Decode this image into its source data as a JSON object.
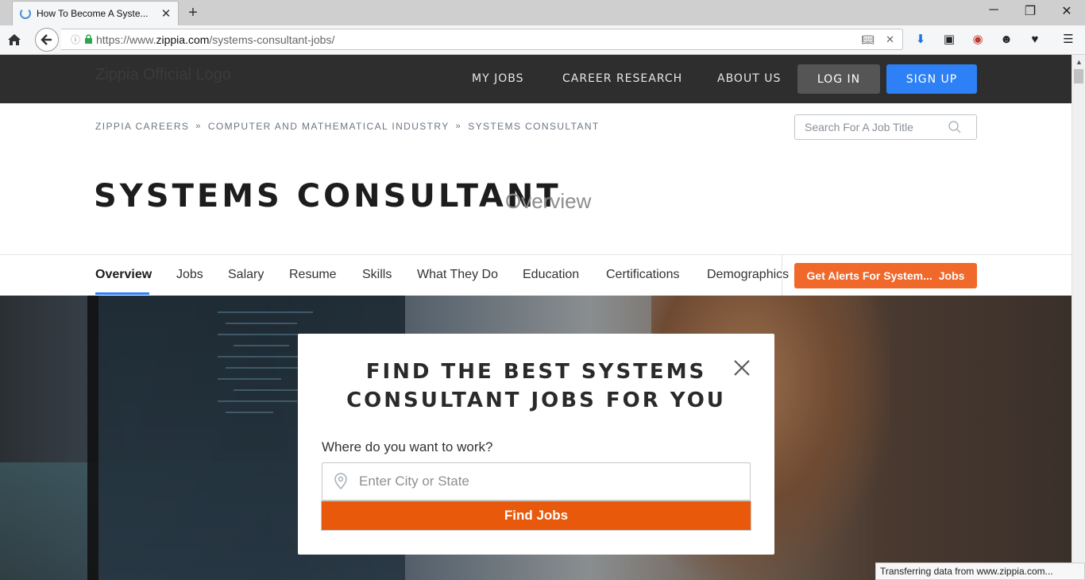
{
  "browser": {
    "tab_title": "How To Become A Syste...",
    "url_prefix": "https://www.",
    "url_domain": "zippia.com",
    "url_path": "/systems-consultant-jobs/",
    "status_text": "Transferring data from www.zippia.com..."
  },
  "header": {
    "logo_alt": "Zippia Official Logo",
    "nav": [
      "MY JOBS",
      "CAREER RESEARCH",
      "ABOUT US"
    ],
    "login_label": "LOG IN",
    "signup_label": "SIGN UP"
  },
  "breadcrumb": [
    "ZIPPIA CAREERS",
    "COMPUTER AND MATHEMATICAL INDUSTRY",
    "SYSTEMS CONSULTANT"
  ],
  "search": {
    "placeholder": "Search For A Job Title"
  },
  "page": {
    "title": "SYSTEMS CONSULTANT",
    "subtitle": "Overview"
  },
  "subnav": {
    "tabs": [
      "Overview",
      "Jobs",
      "Salary",
      "Resume",
      "Skills",
      "What They Do",
      "Education",
      "Certifications",
      "Demographics"
    ],
    "alert_label": "Get Alerts For System...",
    "alert_suffix": "Jobs"
  },
  "modal": {
    "title_line1": "FIND THE BEST SYSTEMS",
    "title_line2": "CONSULTANT JOBS FOR YOU",
    "label": "Where do you want to work?",
    "input_placeholder": "Enter City or State",
    "button_label": "Find Jobs"
  },
  "colors": {
    "header_bg": "#2e2e2e",
    "signup_blue": "#2d80f5",
    "alert_orange": "#f0682a",
    "find_orange": "#e8590c"
  }
}
